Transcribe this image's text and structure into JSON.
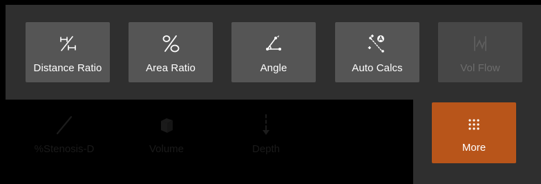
{
  "toolbar": {
    "buttons": [
      {
        "label": "Distance Ratio",
        "icon": "distance-ratio-icon"
      },
      {
        "label": "Area Ratio",
        "icon": "percent-icon"
      },
      {
        "label": "Angle",
        "icon": "angle-icon"
      },
      {
        "label": "Auto Calcs",
        "icon": "auto-calcs-icon"
      },
      {
        "label": "Vol Flow",
        "icon": "vol-flow-icon",
        "state": "disabled"
      }
    ]
  },
  "hidden_tools": [
    {
      "label": "%Stenosis-D",
      "icon": "stenosis-line-icon"
    },
    {
      "label": "Volume",
      "icon": "cube-icon"
    },
    {
      "label": "Depth",
      "icon": "depth-icon"
    }
  ],
  "more": {
    "label": "More",
    "icon": "grid-dots-icon",
    "accent": "#b8551a"
  },
  "colors": {
    "panel": "#2f2f2f",
    "button": "#555555",
    "button_disabled": "#474747",
    "background": "#000000"
  }
}
